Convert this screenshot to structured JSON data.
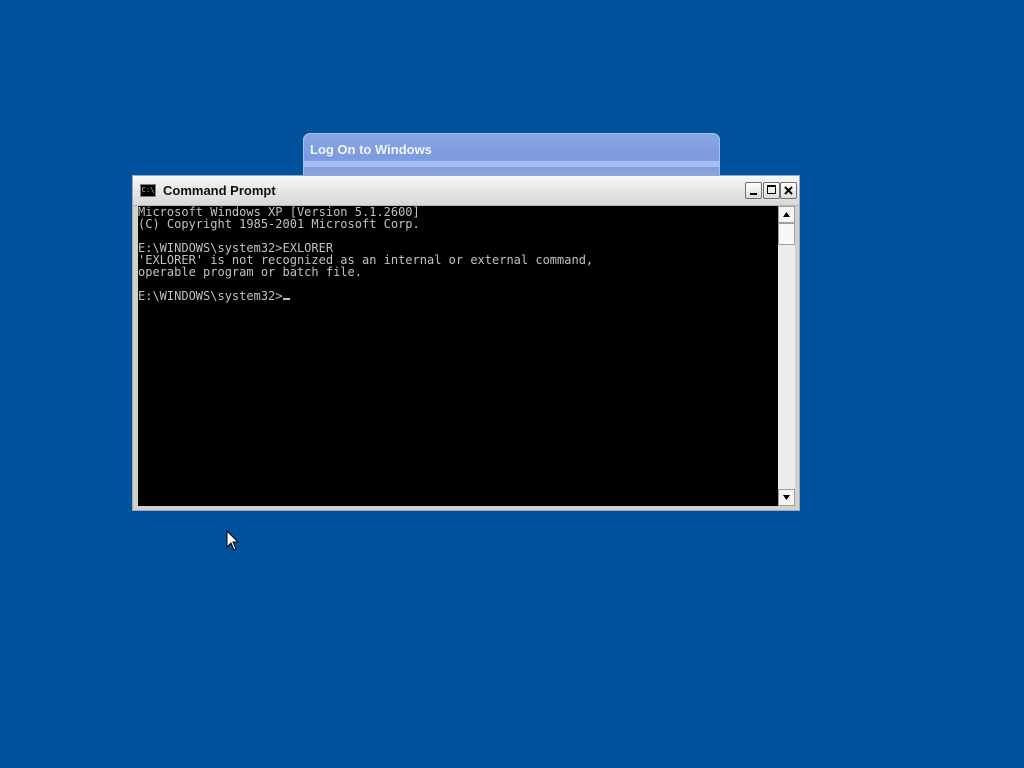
{
  "logon_dialog": {
    "title": "Log On to Windows"
  },
  "cmd_window": {
    "title": "Command Prompt",
    "icon": "console-icon",
    "icon_text": "C:\\",
    "console_lines": [
      "Microsoft Windows XP [Version 5.1.2600]",
      "(C) Copyright 1985-2001 Microsoft Corp.",
      "",
      "E:\\WINDOWS\\system32>EXLORER",
      "'EXLORER' is not recognized as an internal or external command,",
      "operable program or batch file.",
      "",
      "E:\\WINDOWS\\system32>"
    ]
  },
  "colors": {
    "desktop": "#00529c",
    "console_bg": "#000000",
    "console_text": "#c0c0c0"
  }
}
